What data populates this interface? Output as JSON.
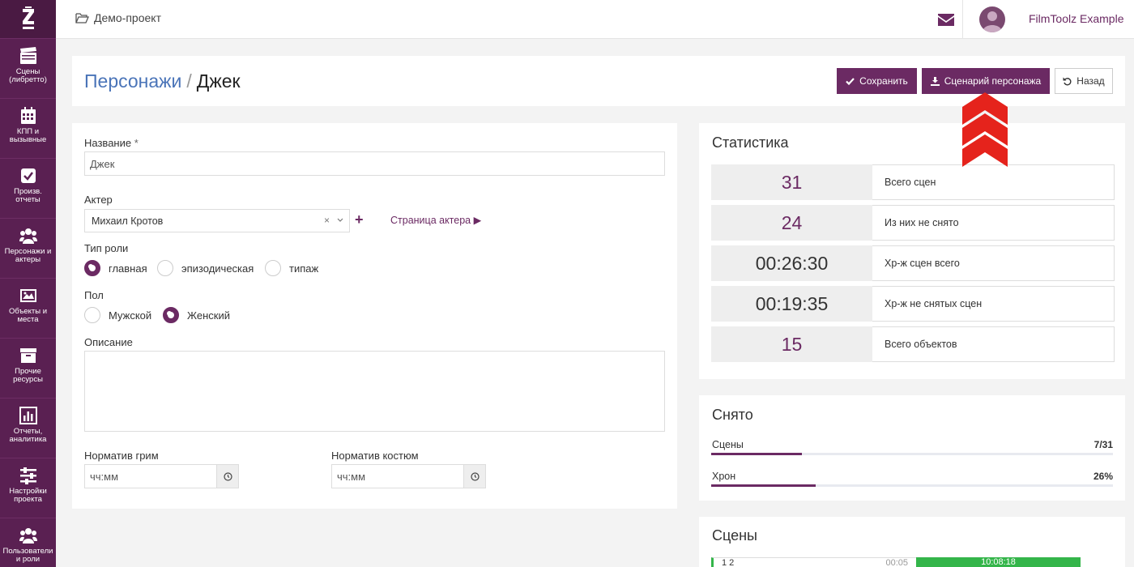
{
  "sidebar": {
    "items": [
      {
        "label": "Сцены (либретто)",
        "icon": "clapperboard-icon"
      },
      {
        "label": "КПП и вызывные",
        "icon": "calendar-icon"
      },
      {
        "label": "Произв. отчеты",
        "icon": "checkbox-icon"
      },
      {
        "label": "Персонажи и актеры",
        "icon": "users-icon"
      },
      {
        "label": "Объекты и места",
        "icon": "image-icon"
      },
      {
        "label": "Прочие ресурсы",
        "icon": "archive-icon"
      },
      {
        "label": "Отчеты, аналитика",
        "icon": "bar-chart-icon"
      },
      {
        "label": "Настройки проекта",
        "icon": "sliders-icon"
      },
      {
        "label": "Пользователи и роли",
        "icon": "users-icon"
      }
    ]
  },
  "topbar": {
    "project": "Демо-проект",
    "user_name": "FilmToolz Example"
  },
  "header": {
    "crumb_parent": "Персонажи",
    "separator": "/",
    "crumb_current": "Джек",
    "save_label": "Сохранить",
    "script_label": "Сценарий персонажа",
    "back_label": "Назад"
  },
  "form": {
    "name_label": "Название",
    "required_mark": "*",
    "name_value": "Джек",
    "actor_label": "Актер",
    "actor_value": "Михаил Кротов",
    "clear_mark": "×",
    "add_mark": "+",
    "actor_link": "Страница актера ▶",
    "role_type_label": "Тип роли",
    "role_options": [
      "главная",
      "эпизодическая",
      "типаж"
    ],
    "role_selected": 0,
    "gender_label": "Пол",
    "gender_options": [
      "Мужской",
      "Женский"
    ],
    "gender_selected": 1,
    "description_label": "Описание",
    "makeup_label": "Норматив грим",
    "makeup_placeholder": "чч:мм",
    "costume_label": "Норматив костюм",
    "costume_placeholder": "чч:мм"
  },
  "stats": {
    "title": "Статистика",
    "rows": [
      {
        "value": "31",
        "label": "Всего сцен"
      },
      {
        "value": "24",
        "label": "Из них не снято"
      },
      {
        "value": "00:26:30",
        "label": "Хр-ж сцен всего"
      },
      {
        "value": "00:19:35",
        "label": "Хр-ж не снятых сцен"
      },
      {
        "value": "15",
        "label": "Всего объектов"
      }
    ]
  },
  "shot": {
    "title": "Снято",
    "scenes_label": "Сцены",
    "scenes_value": "7/31",
    "scenes_fraction": 0.226,
    "chrono_label": "Хрон",
    "chrono_value": "26%",
    "chrono_fraction": 0.26
  },
  "scenes": {
    "title": "Сцены",
    "first_row_left": "1 2",
    "first_row_mid": "00:05",
    "first_row_right": "10:08:18"
  },
  "colors": {
    "brand": "#6b2a63",
    "sidebar": "#5a2052",
    "link": "#4a74b8",
    "success": "#34b54a",
    "arrow": "#e5231c"
  }
}
